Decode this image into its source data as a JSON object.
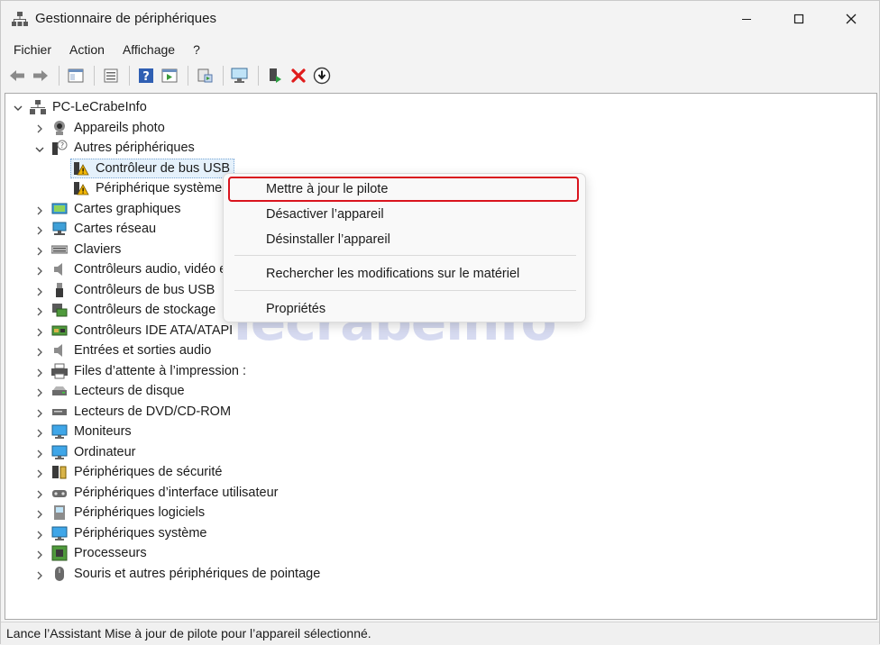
{
  "window": {
    "title": "Gestionnaire de périphériques",
    "icon": "device-manager-icon"
  },
  "menu": [
    "Fichier",
    "Action",
    "Affichage",
    "?"
  ],
  "toolbar": {
    "buttons": [
      "back-arrow-icon",
      "forward-arrow-icon",
      "console-tree-icon",
      "properties-icon",
      "help-icon",
      "action-pane-icon",
      "print-icon",
      "scan-hardware-icon",
      "enable-device-icon",
      "uninstall-x-icon",
      "update-driver-icon"
    ]
  },
  "tree": {
    "root": "PC-LeCrabeInfo",
    "items": [
      {
        "label": "Appareils photo",
        "icon": "camera-icon",
        "expanded": false
      },
      {
        "label": "Autres périphériques",
        "icon": "unknown-device-icon",
        "expanded": true
      },
      {
        "label": "Contrôleur de bus USB",
        "icon": "warning-device-icon",
        "child": true,
        "selected": true
      },
      {
        "label": "Périphérique système",
        "icon": "warning-device-icon",
        "child": true
      },
      {
        "label": "Cartes graphiques",
        "icon": "display-adapter-icon",
        "expanded": false
      },
      {
        "label": "Cartes réseau",
        "icon": "network-icon",
        "expanded": false
      },
      {
        "label": "Claviers",
        "icon": "keyboard-icon",
        "expanded": false
      },
      {
        "label": "Contrôleurs audio, vidéo et jeu",
        "icon": "audio-icon",
        "expanded": false
      },
      {
        "label": "Contrôleurs de bus USB",
        "icon": "usb-icon",
        "expanded": false
      },
      {
        "label": "Contrôleurs de stockage",
        "icon": "storage-icon",
        "expanded": false
      },
      {
        "label": "Contrôleurs IDE ATA/ATAPI",
        "icon": "ide-icon",
        "expanded": false
      },
      {
        "label": "Entrées et sorties audio",
        "icon": "speaker-icon",
        "expanded": false
      },
      {
        "label": "Files d’attente à l’impression :",
        "icon": "printer-icon",
        "expanded": false
      },
      {
        "label": "Lecteurs de disque",
        "icon": "disk-icon",
        "expanded": false
      },
      {
        "label": "Lecteurs de DVD/CD-ROM",
        "icon": "dvd-icon",
        "expanded": false
      },
      {
        "label": "Moniteurs",
        "icon": "monitor-icon",
        "expanded": false
      },
      {
        "label": "Ordinateur",
        "icon": "computer-icon",
        "expanded": false
      },
      {
        "label": "Périphériques de sécurité",
        "icon": "security-icon",
        "expanded": false
      },
      {
        "label": "Périphériques d’interface utilisateur",
        "icon": "hid-icon",
        "expanded": false
      },
      {
        "label": "Périphériques logiciels",
        "icon": "software-device-icon",
        "expanded": false
      },
      {
        "label": "Périphériques système",
        "icon": "system-device-icon",
        "expanded": false
      },
      {
        "label": "Processeurs",
        "icon": "processor-icon",
        "expanded": false
      },
      {
        "label": "Souris et autres périphériques de pointage",
        "icon": "mouse-icon",
        "expanded": false
      }
    ]
  },
  "context_menu": {
    "items": [
      "Mettre à jour le pilote",
      "Désactiver l’appareil",
      "Désinstaller l’appareil",
      "Rechercher les modifications sur le matériel",
      "Propriétés"
    ],
    "highlight_color": "#d9141e"
  },
  "watermark": "lecrabeinfo",
  "status": "Lance l’Assistant Mise à jour de pilote pour l’appareil sélectionné.",
  "colors": {
    "selection": "#e5f1fb",
    "accent": "#0078d4"
  }
}
